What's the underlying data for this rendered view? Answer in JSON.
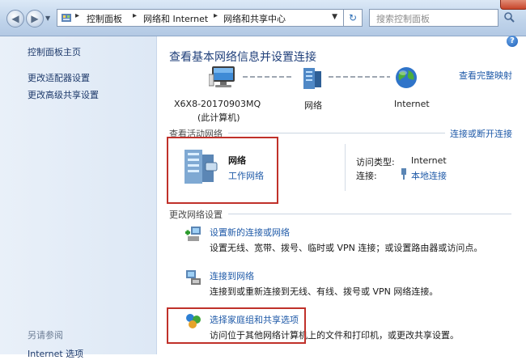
{
  "address_bar": {
    "crumbs": [
      "控制面板",
      "网络和 Internet",
      "网络和共享中心"
    ],
    "search_placeholder": "搜索控制面板"
  },
  "left_pane": {
    "links": [
      "控制面板主页",
      "更改适配器设置",
      "更改高级共享设置"
    ],
    "see_also_heading": "另请参阅",
    "see_also_links": [
      "Internet 选项"
    ]
  },
  "main": {
    "title": "查看基本网络信息并设置连接",
    "full_map_link": "查看完整映射",
    "map": {
      "computer_label": "X6X8-20170903MQ",
      "computer_sub": "(此计算机)",
      "network_label": "网络",
      "internet_label": "Internet"
    },
    "active_networks": {
      "heading": "查看活动网络",
      "connect_link": "连接或断开连接",
      "network_name": "网络",
      "network_type": "工作网络",
      "access_type_label": "访问类型:",
      "access_type_value": "Internet",
      "connections_label": "连接:",
      "connection_link": "本地连接"
    },
    "change_settings": {
      "heading": "更改网络设置",
      "tasks": [
        {
          "link": "设置新的连接或网络",
          "desc": "设置无线、宽带、拨号、临时或 VPN 连接；或设置路由器或访问点。",
          "icon": "new-connection-icon"
        },
        {
          "link": "连接到网络",
          "desc": "连接到或重新连接到无线、有线、拨号或 VPN 网络连接。",
          "icon": "connect-network-icon"
        },
        {
          "link": "选择家庭组和共享选项",
          "desc": "访问位于其他网络计算机上的文件和打印机，或更改共享设置。",
          "icon": "homegroup-icon"
        }
      ]
    }
  },
  "colors": {
    "link": "#1f5aa8",
    "title": "#1f3f7a",
    "highlight_box": "#c0312a",
    "left_pane_bg": "#e4edf8"
  }
}
